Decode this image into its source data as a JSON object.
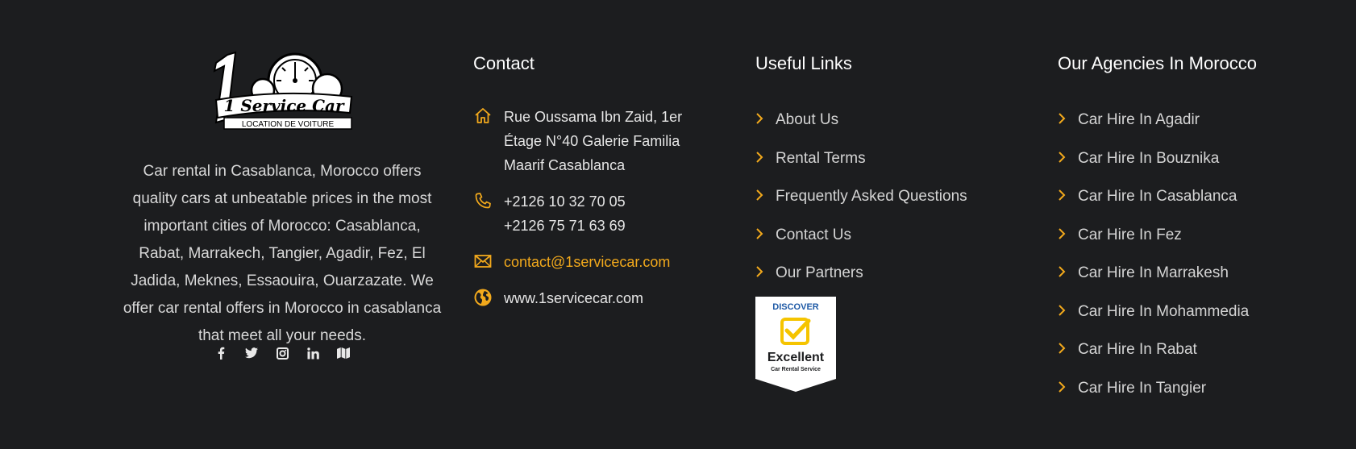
{
  "about": {
    "logo_text": "1 Service Car",
    "logo_subtitle": "LOCATION DE VOITURE",
    "description": "Car rental in Casablanca, Morocco offers quality cars at unbeatable prices in the most important cities of Morocco: Casablanca, Rabat, Marrakech, Tangier, Agadir, Fez, El Jadida, Meknes, Essaouira, Ouarzazate. We offer car rental offers in Morocco in casablanca that meet all your needs.",
    "socials": [
      {
        "icon": "facebook-icon"
      },
      {
        "icon": "twitter-icon"
      },
      {
        "icon": "instagram-icon"
      },
      {
        "icon": "linkedin-icon"
      },
      {
        "icon": "map-icon"
      }
    ]
  },
  "contact": {
    "title": "Contact",
    "address_lines": [
      "Rue Oussama Ibn Zaid, 1er",
      "Étage N°40 Galerie Familia",
      "Maarif Casablanca"
    ],
    "phones": [
      "+2126 10 32 70 05",
      "+2126 75 71 63 69"
    ],
    "email": "contact@1servicecar.com",
    "website": "www.1servicecar.com"
  },
  "useful_links": {
    "title": "Useful Links",
    "items": [
      "About Us",
      "Rental Terms",
      "Frequently Asked Questions",
      "Contact Us",
      "Our Partners"
    ],
    "badge": {
      "top": "DISCOVER",
      "main": "Excellent",
      "sub": "Car Rental Service"
    }
  },
  "agencies": {
    "title": "Our Agencies In Morocco",
    "items": [
      "Car Hire In Agadir",
      "Car Hire In Bouznika",
      "Car Hire In Casablanca",
      "Car Hire In Fez",
      "Car Hire In Marrakesh",
      "Car Hire In Mohammedia",
      "Car Hire In Rabat",
      "Car Hire In Tangier"
    ]
  },
  "colors": {
    "background": "#1c1d1f",
    "accent": "#f2a91c",
    "heading": "#ffffff",
    "text": "#d6d6d6"
  }
}
